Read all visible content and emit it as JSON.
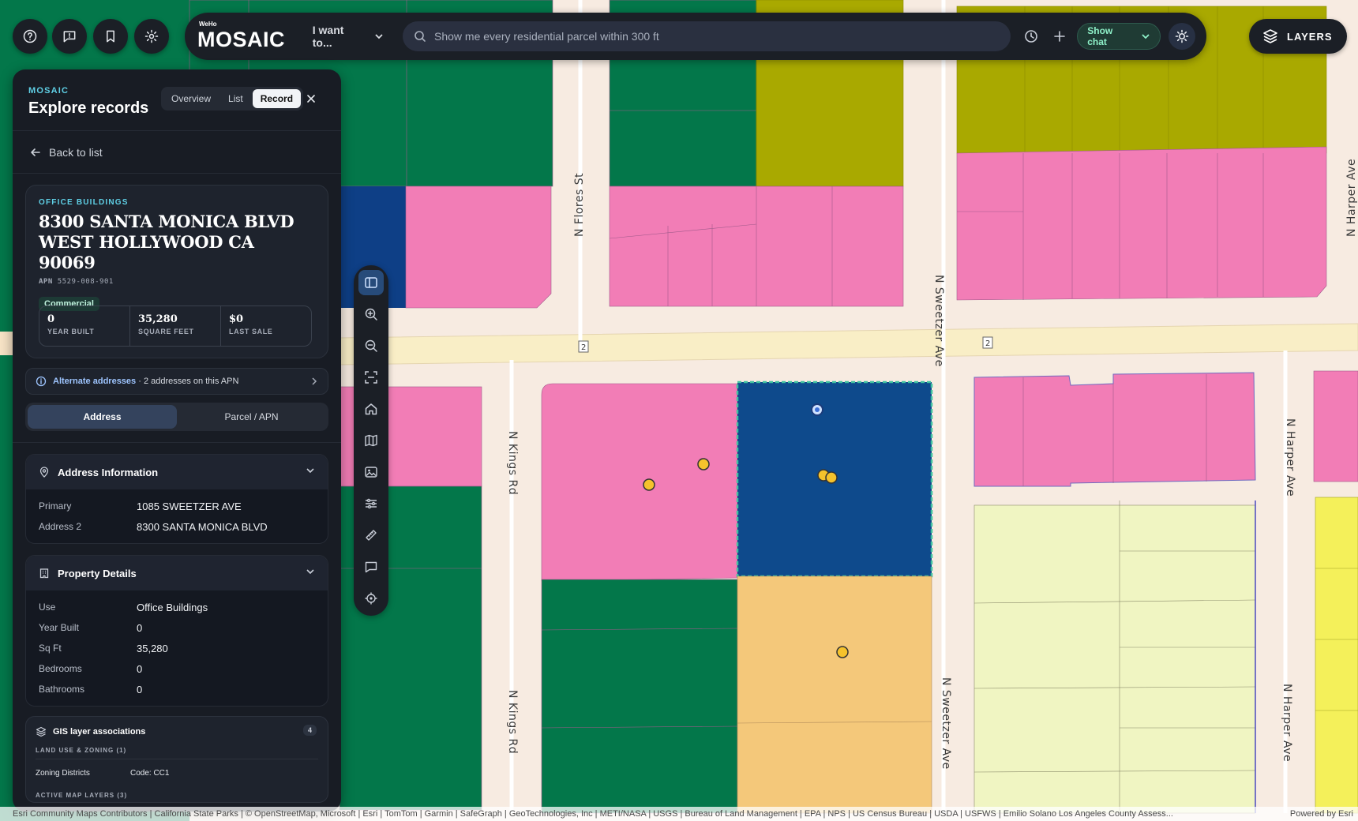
{
  "header": {
    "brand_small": "WeHo",
    "brand_name": "MOSAIC",
    "intent_label": "I want to...",
    "search_placeholder": "Show me every residential parcel within 300 ft",
    "show_chat_label": "Show chat",
    "layers_label": "LAYERS"
  },
  "panel": {
    "kicker": "MOSAIC",
    "title": "Explore records",
    "tabs": [
      {
        "label": "Overview",
        "active": false
      },
      {
        "label": "List",
        "active": false
      },
      {
        "label": "Record",
        "active": true
      }
    ],
    "back_label": "Back to list",
    "record": {
      "category": "OFFICE BUILDINGS",
      "address_line1": "8300 SANTA MONICA BLVD",
      "address_line2": "WEST HOLLYWOOD CA 90069",
      "apn_label": "APN",
      "apn": "5529-008-901",
      "badge": "Commercial",
      "stats": [
        {
          "value": "0",
          "label": "YEAR BUILT"
        },
        {
          "value": "35,280",
          "label": "SQUARE FEET"
        },
        {
          "value": "$0",
          "label": "LAST SALE"
        }
      ]
    },
    "alternate": {
      "link": "Alternate addresses",
      "text": " · 2 addresses on this APN"
    },
    "lookup_toggle": [
      {
        "label": "Address",
        "active": true
      },
      {
        "label": "Parcel / APN",
        "active": false
      }
    ],
    "address_info": {
      "title": "Address Information",
      "rows": [
        {
          "key": "Primary",
          "value": "1085 SWEETZER AVE"
        },
        {
          "key": "Address 2",
          "value": "8300 SANTA MONICA BLVD"
        }
      ]
    },
    "property_details": {
      "title": "Property Details",
      "rows": [
        {
          "key": "Use",
          "value": "Office Buildings"
        },
        {
          "key": "Year Built",
          "value": "0"
        },
        {
          "key": "Sq Ft",
          "value": "35,280"
        },
        {
          "key": "Bedrooms",
          "value": "0"
        },
        {
          "key": "Bathrooms",
          "value": "0"
        }
      ]
    },
    "gis": {
      "title": "GIS layer associations",
      "count": "4",
      "sub1": "LAND USE & ZONING (1)",
      "row_key": "Zoning Districts",
      "row_value": "Code: CC1",
      "sub2": "ACTIVE MAP LAYERS (3)"
    }
  },
  "map": {
    "streets": {
      "flores": "N Flores St",
      "kings": "N Kings Rd",
      "sweetzer": "N Sweetzer Ave",
      "harper": "N Harper Ave",
      "route_shield": "2"
    },
    "colors": {
      "commercial": "#f27db6",
      "office": "#0e4a8c",
      "open_space": "#03774a",
      "mixed": "#a9a900",
      "residential_low": "#f0f5c2",
      "residential_mid": "#f4c87a",
      "yellow": "#f4f05a",
      "street": "#f7ebe1",
      "marker": "#f5c22c"
    }
  },
  "attribution": {
    "left": "Esri Community Maps Contributors | California State Parks | © OpenStreetMap, Microsoft | Esri | TomTom | Garmin | SafeGraph | GeoTechnologies, Inc | METI/NASA | USGS | Bureau of Land Management | EPA | NPS | US Census Bureau | USDA | USFWS | Emilio Solano Los Angeles County Assess...",
    "right": "Powered by Esri"
  }
}
